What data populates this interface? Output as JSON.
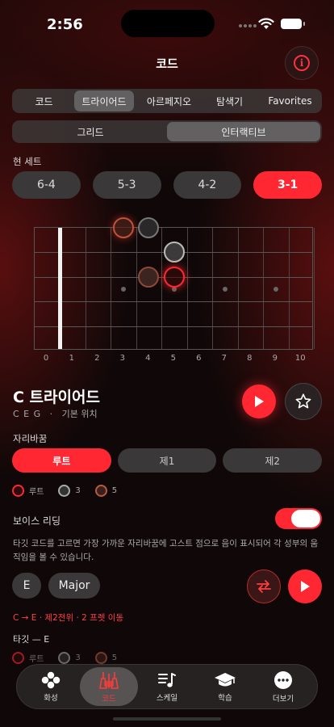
{
  "status": {
    "time": "2:56"
  },
  "header": {
    "title": "코드"
  },
  "main_tabs": [
    {
      "label": "코드",
      "active": false
    },
    {
      "label": "트라이어드",
      "active": true
    },
    {
      "label": "아르페지오",
      "active": false
    },
    {
      "label": "탐색기",
      "active": false
    },
    {
      "label": "Favorites",
      "active": false
    }
  ],
  "view_tabs": [
    {
      "label": "그리드",
      "active": false
    },
    {
      "label": "인터랙티브",
      "active": true
    }
  ],
  "string_sets": {
    "label": "현 세트",
    "items": [
      {
        "label": "6-4",
        "active": false
      },
      {
        "label": "5-3",
        "active": false
      },
      {
        "label": "4-2",
        "active": false
      },
      {
        "label": "3-1",
        "active": true
      }
    ]
  },
  "fretboard": {
    "fret_numbers": [
      "0",
      "1",
      "2",
      "3",
      "4",
      "5",
      "6",
      "7",
      "8",
      "9",
      "10"
    ],
    "inlay_frets": [
      3,
      5,
      7,
      9
    ],
    "notes": [
      {
        "string": 1,
        "fret": 3,
        "role": "root-ghost"
      },
      {
        "string": 1,
        "fret": 4,
        "role": "third-ghost"
      },
      {
        "string": 2,
        "fret": 5,
        "role": "third"
      },
      {
        "string": 3,
        "fret": 4,
        "role": "fifth-ghost"
      },
      {
        "string": 3,
        "fret": 5,
        "role": "root"
      }
    ]
  },
  "chord": {
    "title": "C 트라이어드",
    "notes": "C E G",
    "separator": "·",
    "position": "기본 위치"
  },
  "inversion": {
    "label": "자리바꿈",
    "items": [
      {
        "label": "루트",
        "active": true
      },
      {
        "label": "제1",
        "active": false
      },
      {
        "label": "제2",
        "active": false
      }
    ]
  },
  "legend": {
    "root": "루트",
    "third": "3",
    "fifth": "5"
  },
  "voice_leading": {
    "label": "보이스 리딩",
    "enabled": true,
    "description": "타깃 코드를 고르면 가장 가까운 자리바꿈에 고스트 점으로 음이 표시되어 각 성부의 움직임을 볼 수 있습니다.",
    "key": "E",
    "quality": "Major",
    "movement": "C → E · 제2전위 · 2 프렛 이동",
    "target_label": "타깃 — E"
  },
  "tabbar": [
    {
      "label": "화성",
      "icon": "clover-icon",
      "active": false
    },
    {
      "label": "코드",
      "icon": "guitar-icon",
      "active": true
    },
    {
      "label": "스케일",
      "icon": "score-icon",
      "active": false
    },
    {
      "label": "학습",
      "icon": "graduation-cap-icon",
      "active": false
    },
    {
      "label": "더보기",
      "icon": "more-icon",
      "active": false
    }
  ],
  "colors": {
    "accent": "#ff2832",
    "background": "#100808"
  }
}
